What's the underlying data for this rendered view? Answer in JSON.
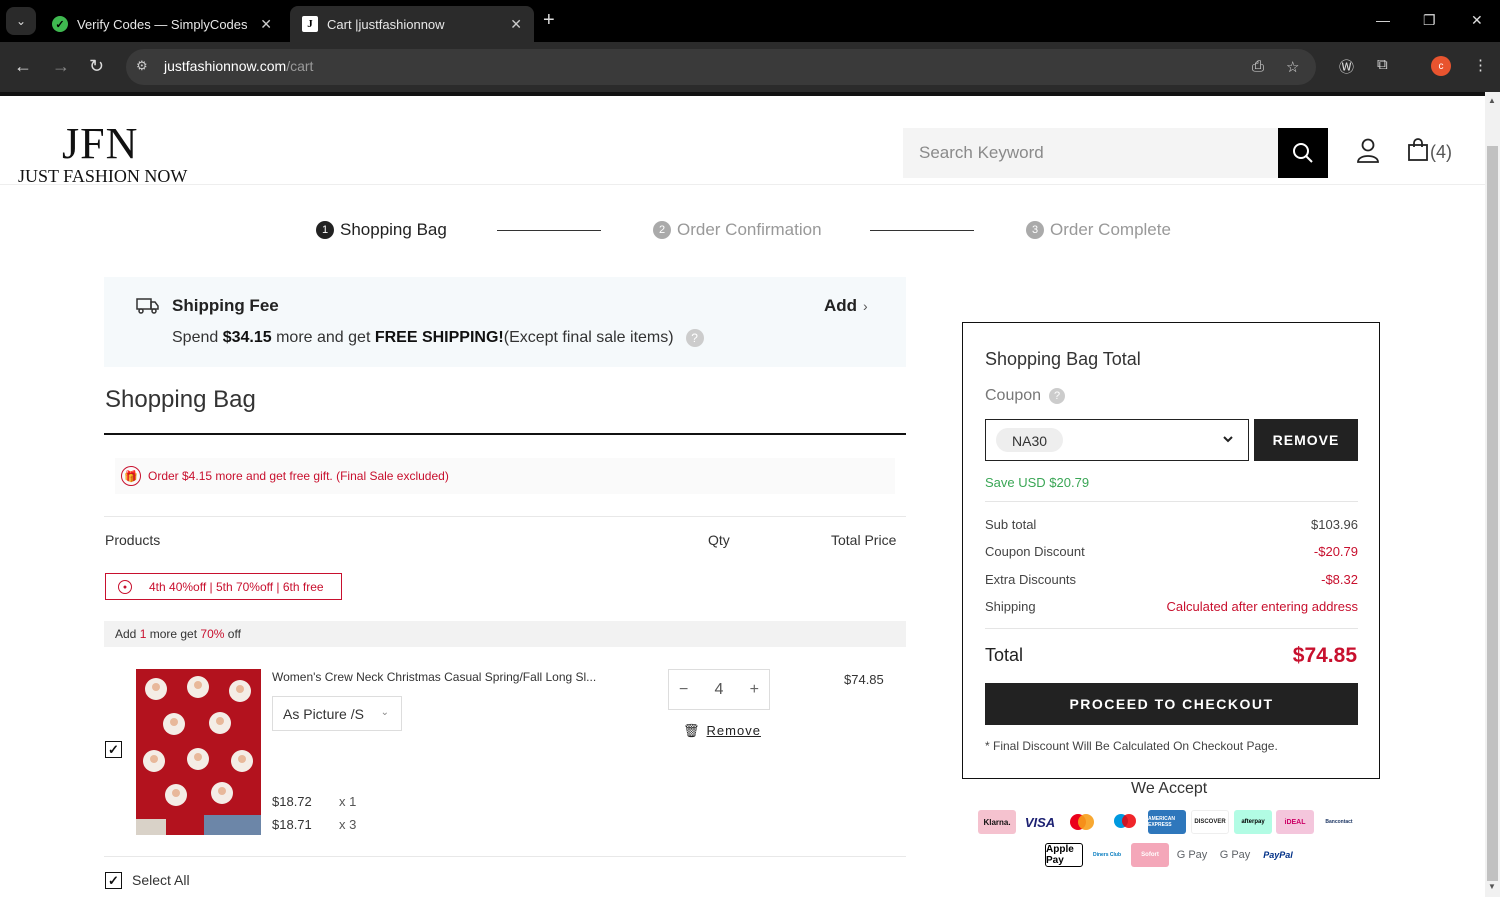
{
  "browser": {
    "tabs": [
      {
        "title": "Verify Codes — SimplyCodes",
        "active": false
      },
      {
        "title": "Cart |justfashionnow",
        "active": true
      }
    ],
    "url_host": "justfashionnow.com",
    "url_path": "/cart",
    "avatar_letter": "c"
  },
  "header": {
    "logo_mark": "JFN",
    "logo_text": "JUST FASHION NOW",
    "search_placeholder": "Search Keyword",
    "bag_count": "(4)"
  },
  "steps": [
    {
      "num": "1",
      "label": "Shopping Bag",
      "active": true
    },
    {
      "num": "2",
      "label": "Order Confirmation",
      "active": false
    },
    {
      "num": "3",
      "label": "Order Complete",
      "active": false
    }
  ],
  "shipping": {
    "title": "Shipping Fee",
    "add_label": "Add",
    "text_pre": "Spend ",
    "amount": "$34.15",
    "text_mid": " more and get ",
    "free": "FREE SHIPPING!",
    "text_post": "(Except final sale items)"
  },
  "bag": {
    "title": "Shopping Bag",
    "gift_text": "Order $4.15 more and get free gift. (Final Sale excluded)",
    "columns": {
      "products": "Products",
      "qty": "Qty",
      "total": "Total Price"
    },
    "promo_tag": "4th 40%off | 5th 70%off | 6th free",
    "addmore": {
      "pre": "Add ",
      "num": "1",
      "mid": " more get ",
      "pct": "70%",
      "post": " off"
    },
    "item": {
      "name": "Women's Crew Neck Christmas Casual Spring/Fall Long Sl...",
      "variant": "As Picture /S",
      "qty": "4",
      "remove_label": "Remove",
      "line_total": "$74.85",
      "prices": [
        {
          "price": "$18.72",
          "mult": "x 1"
        },
        {
          "price": "$18.71",
          "mult": "x 3"
        }
      ],
      "checked": true
    },
    "select_all_label": "Select All"
  },
  "summary": {
    "title": "Shopping Bag Total",
    "coupon_label": "Coupon",
    "coupon_code": "NA30",
    "remove_label": "REMOVE",
    "save_text": "Save USD $20.79",
    "rows": [
      {
        "label": "Sub total",
        "value": "$103.96",
        "red": false
      },
      {
        "label": "Coupon Discount",
        "value": "-$20.79",
        "red": true
      },
      {
        "label": "Extra Discounts",
        "value": "-$8.32",
        "red": true
      },
      {
        "label": "Shipping",
        "value": "Calculated after entering address",
        "red": true
      }
    ],
    "total_label": "Total",
    "total_value": "$74.85",
    "checkout_label": "PROCEED TO CHECKOUT",
    "final_note": "* Final Discount Will Be Calculated On Checkout Page."
  },
  "payments": {
    "title": "We Accept",
    "row1": [
      "Klarna.",
      "VISA",
      "mastercard",
      "maestro",
      "AMERICAN EXPRESS",
      "DISCOVER",
      "afterpay",
      "iDEAL",
      "Bancontact"
    ],
    "row2": [
      "Apple Pay",
      "Diners Club",
      "Sofort",
      "G Pay",
      "G Pay",
      "PayPal"
    ]
  },
  "colors": {
    "accent_red": "#c8102e",
    "save_green": "#3aa655",
    "dark": "#222222"
  }
}
